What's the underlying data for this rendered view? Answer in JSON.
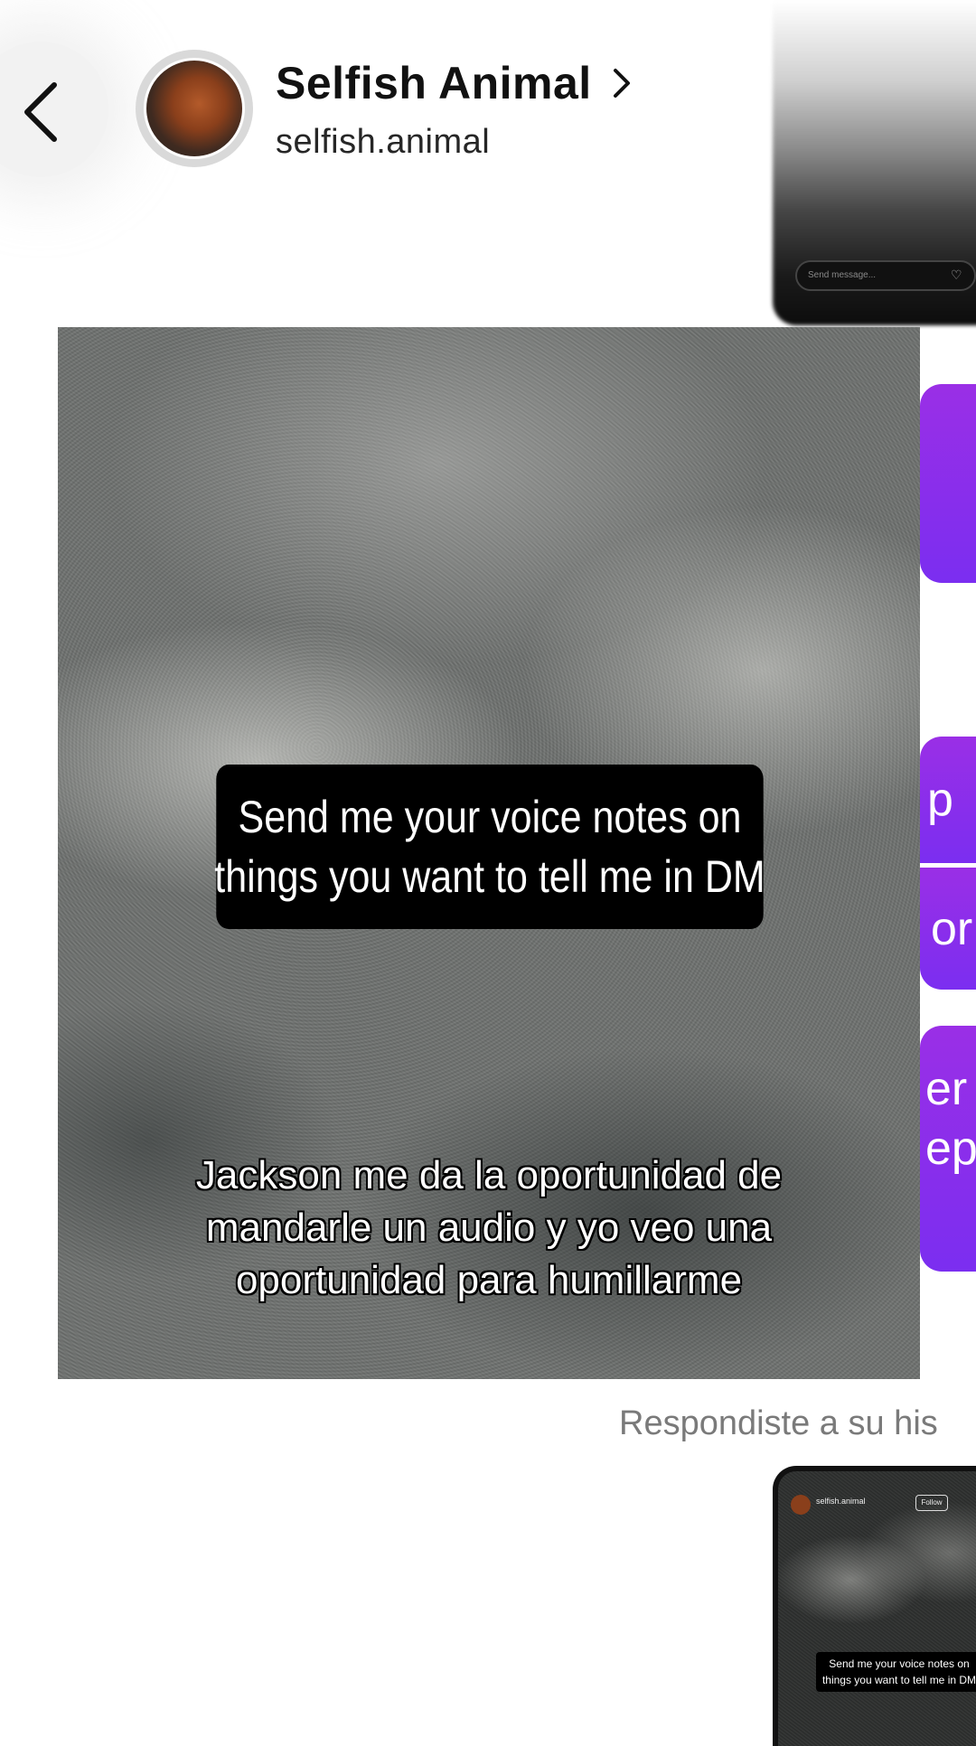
{
  "header": {
    "name": "Selfish Animal",
    "username": "selfish.animal",
    "back_icon": "chevron-left-icon",
    "name_chevron_icon": "chevron-right-icon"
  },
  "thumb_top": {
    "input_placeholder": "Send message..."
  },
  "purple_peek": {
    "texts": [
      "p",
      "or",
      "er",
      "ep"
    ],
    "color": "#8a2be2"
  },
  "story": {
    "caption_lines": [
      "Send me your voice notes on",
      "things you want to tell me in DM"
    ],
    "overlay_lines": [
      "Jackson me da la oportunidad de",
      "mandarle un audio y yo veo una",
      "oportunidad para humillarme"
    ]
  },
  "replied_label": "Respondiste a su his",
  "thumb_bottom": {
    "username": "selfish.animal",
    "follow_label": "Follow",
    "caption_lines": [
      "Send me your voice notes on",
      "things you want to tell me in DM"
    ]
  }
}
